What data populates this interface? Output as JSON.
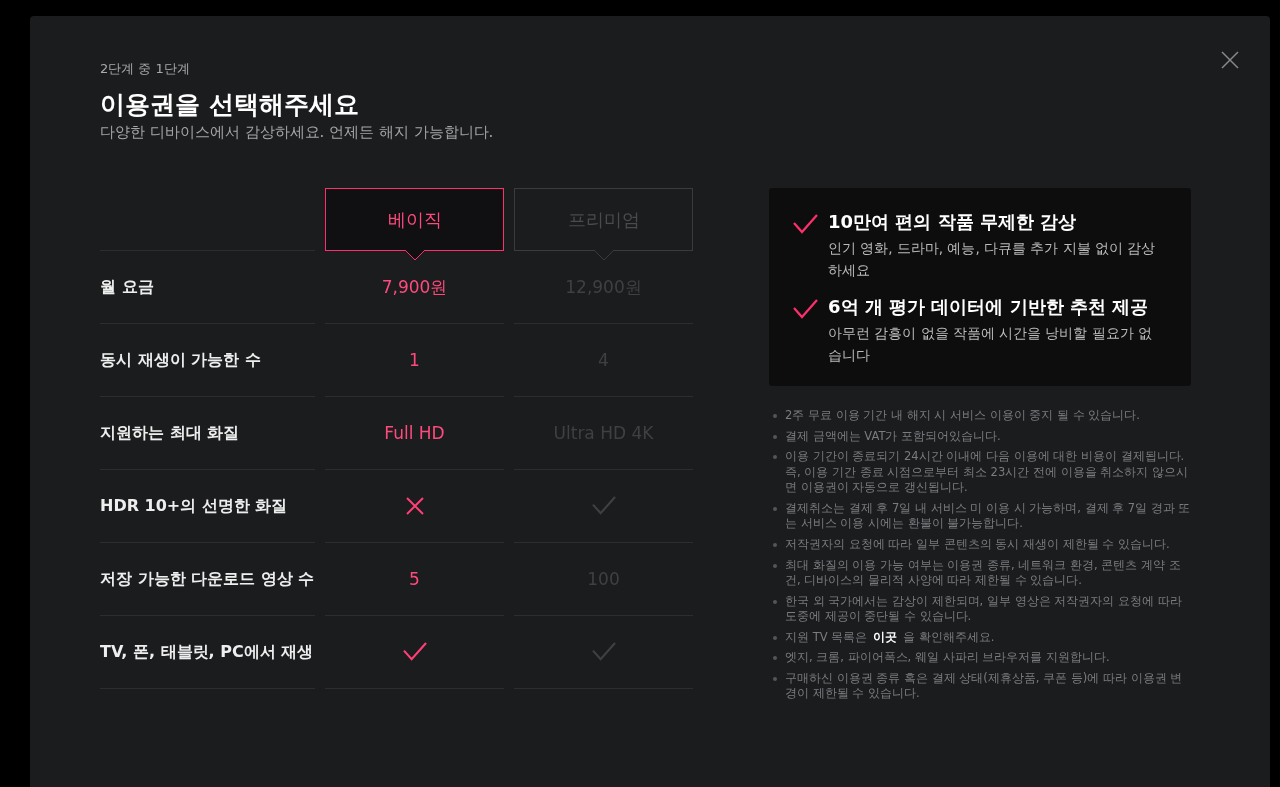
{
  "step": "2단계 중 1단계",
  "title": "이용권을 선택해주세요",
  "subtitle": "다양한 디바이스에서 감상하세요. 언제든 해지 가능합니다.",
  "plans": [
    {
      "name": "베이직",
      "selected": true
    },
    {
      "name": "프리미엄",
      "selected": false
    }
  ],
  "rows": [
    {
      "label": "월 요금",
      "cells": [
        {
          "kind": "text",
          "text": "7,900원"
        },
        {
          "kind": "text",
          "text": "12,900원"
        }
      ]
    },
    {
      "label": "동시 재생이 가능한 수",
      "cells": [
        {
          "kind": "text",
          "text": "1"
        },
        {
          "kind": "text",
          "text": "4"
        }
      ]
    },
    {
      "label": "지원하는 최대 화질",
      "cells": [
        {
          "kind": "text",
          "text": "Full HD"
        },
        {
          "kind": "text",
          "text": "Ultra HD 4K"
        }
      ]
    },
    {
      "label": "HDR 10+의 선명한 화질",
      "cells": [
        {
          "kind": "cross"
        },
        {
          "kind": "check"
        }
      ]
    },
    {
      "label": "저장 가능한 다운로드 영상 수",
      "cells": [
        {
          "kind": "text",
          "text": "5"
        },
        {
          "kind": "text",
          "text": "100"
        }
      ]
    },
    {
      "label": "TV, 폰, 태블릿, PC에서 재생",
      "cells": [
        {
          "kind": "check"
        },
        {
          "kind": "check"
        }
      ]
    }
  ],
  "benefits": [
    {
      "title": "10만여 편의 작품 무제한 감상",
      "text": "인기 영화, 드라마, 예능, 다큐를 추가 지불 없이 감상하세요"
    },
    {
      "title": "6억 개 평가 데이터에 기반한 추천 제공",
      "text": "아무런 감흥이 없을 작품에 시간을 낭비할 필요가 없습니다"
    }
  ],
  "notes": [
    {
      "text": "2주 무료 이용 기간 내 해지 시 서비스 이용이 중지 될 수 있습니다."
    },
    {
      "text": "결제 금액에는 VAT가 포함되어있습니다."
    },
    {
      "text": "이용 기간이 종료되기 24시간 이내에 다음 이용에 대한 비용이 결제됩니다. 즉, 이용 기간 종료 시점으로부터 최소 23시간 전에 이용을 취소하지 않으시면 이용권이 자동으로 갱신됩니다."
    },
    {
      "text": "결제취소는 결제 후 7일 내 서비스 미 이용 시 가능하며, 결제 후 7일 경과 또는 서비스 이용 시에는 환불이 불가능합니다."
    },
    {
      "text": "저작권자의 요청에 따라 일부 콘텐츠의 동시 재생이 제한될 수 있습니다."
    },
    {
      "text": "최대 화질의 이용 가능 여부는 이용권 종류, 네트워크 환경, 콘텐츠 계약 조건, 디바이스의 물리적 사양에 따라 제한될 수 있습니다."
    },
    {
      "text": "한국 외 국가에서는 감상이 제한되며, 일부 영상은 저작권자의 요청에 따라 도중에 제공이 중단될 수 있습니다."
    },
    {
      "text": "지원 TV 목록은",
      "link": "이곳",
      "after": "을 확인해주세요."
    },
    {
      "text": "엣지, 크롬, 파이어폭스, 웨일 사파리 브라우저를 지원합니다."
    },
    {
      "text": "구매하신 이용권 종류 혹은 결제 상태(제휴상품, 쿠폰 등)에 따라 이용권 변경이 제한될 수 있습니다."
    }
  ]
}
